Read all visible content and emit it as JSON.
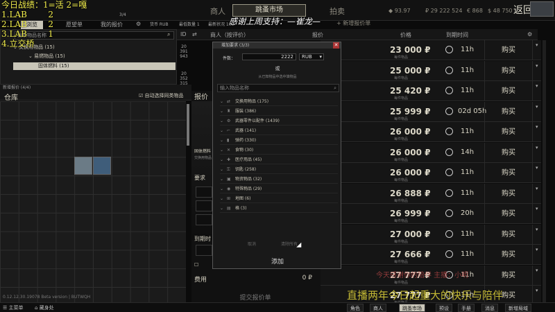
{
  "overlay": {
    "lines": [
      "今日战绩：1=活 2=嘎",
      "1.LAB        2",
      "2.LAB        2",
      "3.LAB        1",
      "4.立交桥"
    ]
  },
  "topbar": {
    "tabs": [
      "商人",
      "跳蚤市场",
      "拍卖"
    ],
    "balance_rub": "₽ 29 222 524",
    "balance_eur": "€ 868",
    "balance_usd": "$ 48 750",
    "rating": "93.97",
    "add_offer": "+ 新增报价单",
    "back": "返回",
    "gift": "感谢上周支持：—崔龙—"
  },
  "subtabs": {
    "browse": "浏览",
    "wishlist": "愿望单",
    "my_offers": "我的报价",
    "count": "3/4",
    "currency_filter": "货币 RUB",
    "min_qty": "最低数量 1",
    "condition": "最新状况 100"
  },
  "filter": {
    "search_placeholder": "搜索物品名称",
    "tree": [
      {
        "label": "交换用物品 (15)",
        "level": 0
      },
      {
        "label": "易燃物品 (15)",
        "level": 1
      },
      {
        "label": "固体燃料 (15)",
        "level": 2,
        "selected": true
      }
    ]
  },
  "warehouse": {
    "head": "新增报价 (4/4)",
    "title": "仓库",
    "auto_select": "自动选择同类物品",
    "version": "0.12.12.30.19078 Beta version | BUTWQH"
  },
  "offer": {
    "title": "报价",
    "item_name": "固体燃料",
    "item_sub": "交换用物品",
    "requirements": "要求",
    "expiry": "到期时",
    "fee_label": "费用",
    "fee_value": "0 ₽",
    "submit": "提交报价单"
  },
  "table": {
    "headers": {
      "id": "ID",
      "merchant": "商人（按评价）",
      "offer": "报价",
      "price": "价格",
      "expires": "到期时间"
    },
    "ids": [
      "20 391 943",
      "20 352 315"
    ],
    "rows": [
      {
        "price": "23 000 ₽",
        "per": "每件物品",
        "time": "11h",
        "buy": "购买"
      },
      {
        "price": "25 000 ₽",
        "per": "每件物品",
        "time": "11h",
        "buy": "购买"
      },
      {
        "price": "25 420 ₽",
        "per": "每件物品",
        "time": "11h",
        "buy": "购买"
      },
      {
        "price": "25 999 ₽",
        "per": "每件物品",
        "time": "02d 05h",
        "buy": "购买"
      },
      {
        "price": "26 000 ₽",
        "per": "每件物品",
        "time": "11h",
        "buy": "购买"
      },
      {
        "price": "26 000 ₽",
        "per": "每件物品",
        "time": "14h",
        "buy": "购买"
      },
      {
        "price": "26 000 ₽",
        "per": "每件物品",
        "time": "11h",
        "buy": "购买"
      },
      {
        "price": "26 888 ₽",
        "per": "每件物品",
        "time": "11h",
        "buy": "购买"
      },
      {
        "price": "26 999 ₽",
        "per": "每件物品",
        "time": "20h",
        "buy": "购买"
      },
      {
        "price": "27 000 ₽",
        "per": "每件物品",
        "time": "11h",
        "buy": "购买"
      },
      {
        "price": "27 666 ₽",
        "per": "每件物品",
        "time": "11h",
        "buy": "购买"
      },
      {
        "price": "27 777 ₽",
        "per": "每件物品",
        "time": "11h",
        "buy": "购买"
      },
      {
        "price": "27 777 ₽",
        "per": "每件物品",
        "time": "11h",
        "buy": "购买"
      }
    ]
  },
  "dialog": {
    "title": "增加要求 (3/3)",
    "qty_label": "件数：",
    "qty_value": "2222",
    "currency": "RUB",
    "or": "或",
    "note": "从已知物品中选中填物品",
    "search_placeholder": "输入物品名称",
    "categories": [
      "交换用物品 (175)",
      "服装 (386)",
      "武器零件以配件 (1439)",
      "武器 (141)",
      "弹药 (330)",
      "食物 (30)",
      "医疗用品 (45)",
      "钥匙 (258)",
      "物资物品 (32)",
      "特殊物品 (29)",
      "地图 (6)",
      "格 (3)"
    ],
    "cancel": "取消",
    "clear": "清除所有",
    "add": "添加"
  },
  "bottombar": {
    "main_menu": "主菜单",
    "hideout": "藏身处",
    "character": "角色",
    "trader": "商人",
    "flea": "跳蚤市场",
    "preset": "预设",
    "handbook": "手册",
    "messages": "消息",
    "clothing": "新增局域"
  },
  "stream": {
    "banner": "直播两年今日起重大的快乐与陪伴",
    "banner2": "今天感谢你的陪伴 主播：小明",
    "colors": {
      "accent": "#c9c6b8",
      "overlay": "#f0ec4b",
      "close": "#aa3333"
    }
  }
}
